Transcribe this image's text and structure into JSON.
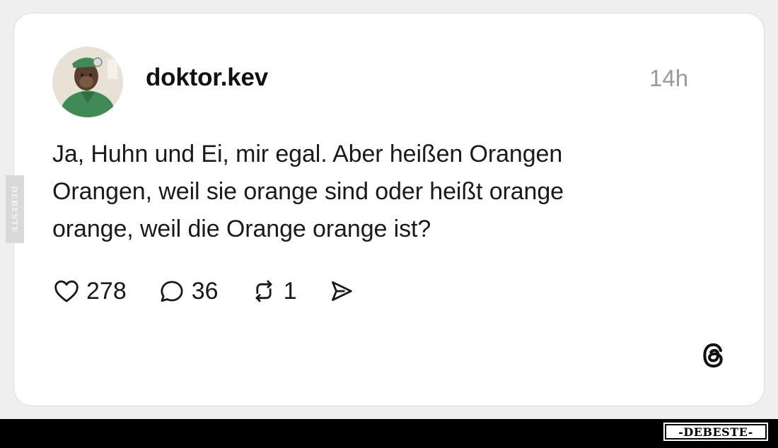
{
  "post": {
    "username": "doktor.kev",
    "timestamp": "14h",
    "text_lines": [
      "Ja, Huhn und Ei, mir egal. Aber heißen Orangen",
      "Orangen, weil sie orange sind oder heißt orange",
      "orange, weil die Orange orange ist?"
    ]
  },
  "actions": {
    "likes": "278",
    "comments": "36",
    "reposts": "1"
  },
  "icons": {
    "like": "heart-icon",
    "comment": "comment-bubble-icon",
    "repost": "repost-icon",
    "share": "send-icon",
    "platform": "threads-logo-icon"
  },
  "watermark": {
    "side": "DEBESTE",
    "footer": "-DEBESTE-"
  },
  "colors": {
    "card_bg": "#ffffff",
    "text": "#1a1a1a",
    "timestamp": "#9a9a9a",
    "footer_bar": "#000000"
  }
}
